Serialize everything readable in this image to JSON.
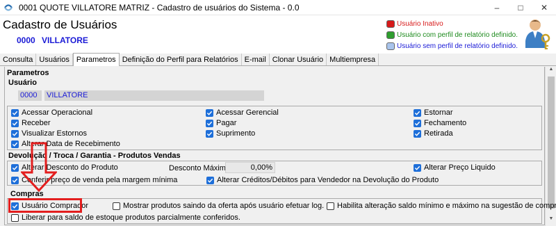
{
  "window": {
    "title": "0001 QUOTE VILLATORE MATRIZ - Cadastro de usuários do Sistema - 0.0"
  },
  "header": {
    "title": "Cadastro de Usuários",
    "company_code": "0000",
    "company_name": "VILLATORE",
    "legend": [
      {
        "label": "Usuário Inativo",
        "color": "#d71a1a",
        "text_color": "#d71a1a"
      },
      {
        "label": "Usuário com perfil de relatório definido.",
        "color": "#2e9e2e",
        "text_color": "#1d8a1d"
      },
      {
        "label": "Usuário sem perfil de relatório definido.",
        "color": "#a9c4ec",
        "text_color": "#1a1ad6"
      }
    ]
  },
  "tabs": [
    "Consulta",
    "Usuários",
    "Parametros",
    "Definição do Perfil para Relatórios",
    "E-mail",
    "Clonar Usuário",
    "Multiempresa"
  ],
  "active_tab": "Parametros",
  "parametros": {
    "section_title": "Parametros",
    "usuario_label": "Usuário",
    "user_code": "0000",
    "user_name": "VILLATORE",
    "permissions": [
      {
        "label": "Acessar Operacional",
        "checked": true
      },
      {
        "label": "Acessar Gerencial",
        "checked": true
      },
      {
        "label": "Estornar",
        "checked": true
      },
      {
        "label": "Receber",
        "checked": true
      },
      {
        "label": "Pagar",
        "checked": true
      },
      {
        "label": "Fechamento",
        "checked": true
      },
      {
        "label": "Visualizar Estornos",
        "checked": true
      },
      {
        "label": "Suprimento",
        "checked": true
      },
      {
        "label": "Retirada",
        "checked": true
      },
      {
        "label": "Alterar Data de Recebimento",
        "checked": true
      }
    ],
    "devolucao": {
      "title": "Devolução / Troca / Garantia - Produtos Vendas",
      "alterar_desconto": "Alterar Desconto do Produto",
      "desconto_maximo_label": "Desconto Máximo:",
      "desconto_maximo_value": "0,00%",
      "alterar_preco_liquido": "Alterar Preço Liquido",
      "conferir_preco": "Conferir preço de venda pela margem mínima",
      "alterar_creditos": "Alterar Créditos/Débitos para Vendedor na Devolução do Produto"
    },
    "compras": {
      "title": "Compras",
      "usuario_comprador": "Usuário Comprador",
      "mostrar_produtos": "Mostrar produtos saindo da oferta após usuário efetuar log.",
      "habilita_alteracao": "Habilita alteração saldo mínimo e máximo na sugestão de compras.",
      "liberar_saldo": "Liberar para saldo de estoque produtos parcialmente conferidos."
    }
  },
  "highlight_color": "#e31e1e"
}
